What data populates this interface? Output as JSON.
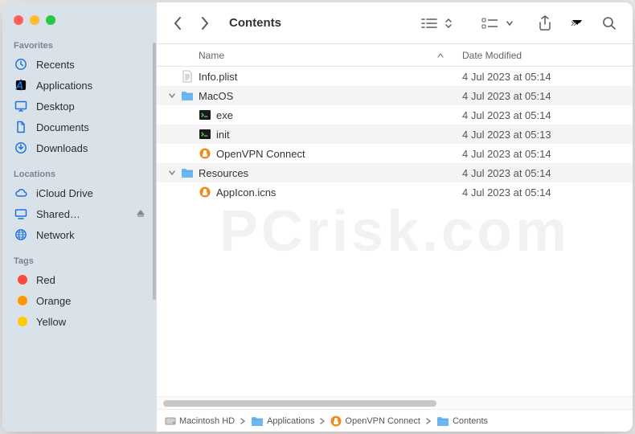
{
  "window_title": "Contents",
  "sidebar": {
    "sections": [
      {
        "title": "Favorites",
        "items": [
          {
            "label": "Recents",
            "icon": "clock"
          },
          {
            "label": "Applications",
            "icon": "apps"
          },
          {
            "label": "Desktop",
            "icon": "desktop"
          },
          {
            "label": "Documents",
            "icon": "doc"
          },
          {
            "label": "Downloads",
            "icon": "download"
          }
        ]
      },
      {
        "title": "Locations",
        "items": [
          {
            "label": "iCloud Drive",
            "icon": "cloud"
          },
          {
            "label": "Shared…",
            "icon": "display",
            "eject": true
          },
          {
            "label": "Network",
            "icon": "globe"
          }
        ]
      },
      {
        "title": "Tags",
        "items": [
          {
            "label": "Red",
            "color": "#ff4b3e"
          },
          {
            "label": "Orange",
            "color": "#ff9500"
          },
          {
            "label": "Yellow",
            "color": "#ffcc00"
          }
        ]
      }
    ]
  },
  "columns": {
    "name": "Name",
    "date": "Date Modified"
  },
  "files": [
    {
      "depth": 0,
      "expandable": false,
      "expanded": false,
      "icon": "plist",
      "name": "Info.plist",
      "date": "4 Jul 2023 at 05:14"
    },
    {
      "depth": 0,
      "expandable": true,
      "expanded": true,
      "icon": "folder",
      "name": "MacOS",
      "date": "4 Jul 2023 at 05:14"
    },
    {
      "depth": 1,
      "expandable": false,
      "expanded": false,
      "icon": "exec",
      "name": "exe",
      "date": "4 Jul 2023 at 05:14"
    },
    {
      "depth": 1,
      "expandable": false,
      "expanded": false,
      "icon": "exec",
      "name": "init",
      "date": "4 Jul 2023 at 05:13"
    },
    {
      "depth": 1,
      "expandable": false,
      "expanded": false,
      "icon": "ovpn",
      "name": "OpenVPN Connect",
      "date": "4 Jul 2023 at 05:14"
    },
    {
      "depth": 0,
      "expandable": true,
      "expanded": true,
      "icon": "folder",
      "name": "Resources",
      "date": "4 Jul 2023 at 05:14"
    },
    {
      "depth": 1,
      "expandable": false,
      "expanded": false,
      "icon": "ovpn",
      "name": "AppIcon.icns",
      "date": "4 Jul 2023 at 05:14"
    }
  ],
  "pathbar": [
    {
      "icon": "hdd",
      "label": "Macintosh HD"
    },
    {
      "icon": "folder",
      "label": "Applications"
    },
    {
      "icon": "ovpn",
      "label": "OpenVPN Connect"
    },
    {
      "icon": "folder",
      "label": "Contents"
    }
  ],
  "watermark": "PCrisk.com"
}
